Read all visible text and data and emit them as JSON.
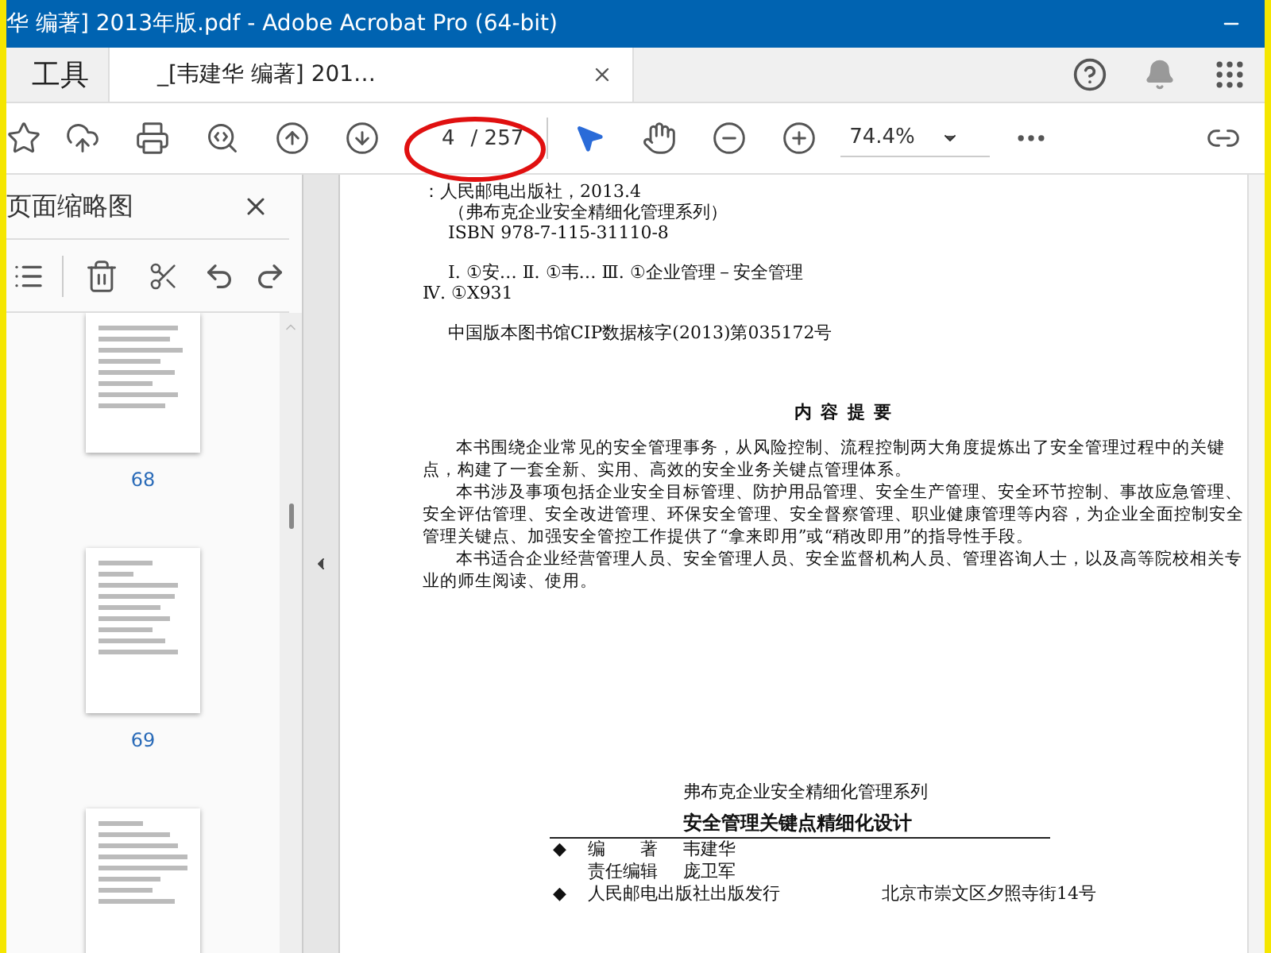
{
  "window": {
    "title": "华 编著] 2013年版.pdf - Adobe Acrobat Pro (64-bit)"
  },
  "tabs": [
    {
      "label": "工具",
      "selected": false,
      "closable": false
    },
    {
      "label": "_[韦建华 编著] 201…",
      "selected": true,
      "closable": true
    }
  ],
  "toolbar": {
    "page_current": "4",
    "page_total": "/ 257",
    "zoom": "74.4%",
    "page_highlighted": true
  },
  "sidebar": {
    "title": "页面缩略图",
    "thumbnails": [
      {
        "label": "68",
        "selected": false
      },
      {
        "label": "69",
        "selected": false
      },
      {
        "selected": false
      }
    ]
  },
  "document": {
    "cip_blocks": [
      [
        {
          "text": "：人民邮电出版社，2013.4",
          "kind": "flush"
        },
        {
          "text": "（弗布克企业安全精细化管理系列）",
          "kind": "indented"
        },
        {
          "text": "ISBN 978-7-115-31110-8",
          "kind": "indented"
        }
      ],
      [
        {
          "text": "Ⅰ. ①安… Ⅱ. ①韦… Ⅲ. ①企业管理－安全管理",
          "kind": "indented"
        },
        {
          "text": "Ⅳ. ①X931",
          "kind": "flush"
        }
      ],
      [
        {
          "text": "中国版本图书馆CIP数据核字(2013)第035172号",
          "kind": "indented"
        }
      ]
    ],
    "summary_title": "内 容 提 要",
    "summary_paragraphs": [
      "本书围绕企业常见的安全管理事务，从风险控制、流程控制两大角度提炼出了安全管理过程中的关键点，构建了一套全新、实用、高效的安全业务关键点管理体系。",
      "本书涉及事项包括企业安全目标管理、防护用品管理、安全生产管理、安全环节控制、事故应急管理、安全评估管理、安全改进管理、环保安全管理、安全督察管理、职业健康管理等内容，为企业全面控制安全管理关键点、加强安全管控工作提供了“拿来即用”或“稍改即用”的指导性手段。",
      "本书适合企业经营管理人员、安全管理人员、安全监督机构人员、管理咨询人士，以及高等院校相关专业的师生阅读、使用。"
    ],
    "series": "弗布克企业安全精细化管理系列",
    "book_title": "安全管理关键点精细化设计",
    "credits": [
      {
        "bullet": "◆",
        "role": "编　　著",
        "value": "韦建华"
      },
      {
        "role": "责任编辑",
        "value": "庞卫军"
      },
      {
        "bullet": "◆",
        "role": "人民邮电出版社出版发行",
        "address": "北京市崇文区夕照寺街14号"
      }
    ]
  }
}
